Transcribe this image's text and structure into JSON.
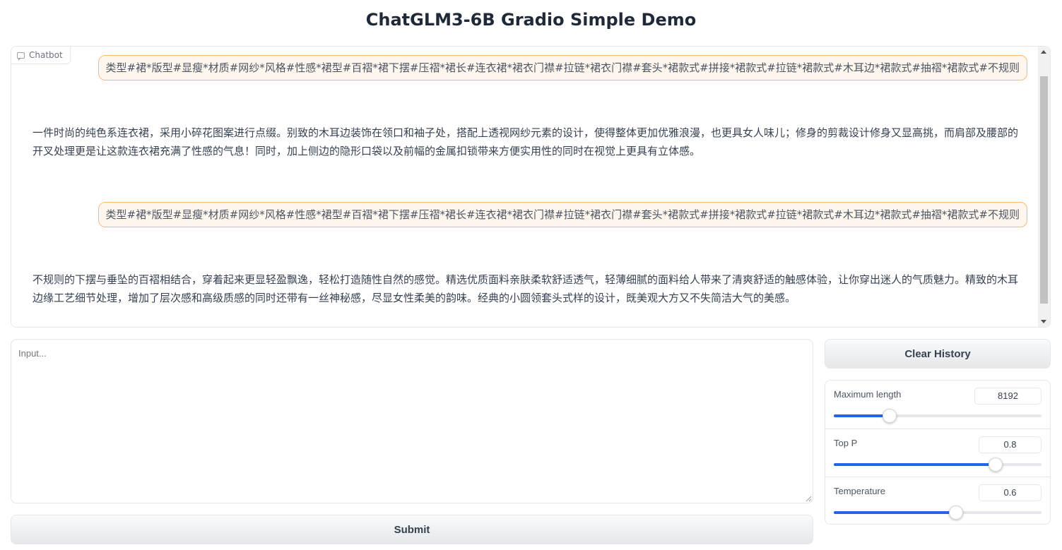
{
  "page": {
    "title": "ChatGLM3-6B Gradio Simple Demo"
  },
  "chatbot": {
    "label": "Chatbot",
    "icon": "chat-bubble-icon",
    "messages": [
      {
        "role": "user",
        "text": "类型#裙*版型#显瘦*材质#网纱*风格#性感*裙型#百褶*裙下摆#压褶*裙长#连衣裙*裙衣门襟#拉链*裙衣门襟#套头*裙款式#拼接*裙款式#拉链*裙款式#木耳边*裙款式#抽褶*裙款式#不规则"
      },
      {
        "role": "assistant",
        "text": "一件时尚的纯色系连衣裙，采用小碎花图案进行点缀。别致的木耳边装饰在领口和袖子处，搭配上透视网纱元素的设计，使得整体更加优雅浪漫，也更具女人味儿；修身的剪裁设计修身又显高挑，而肩部及腰部的开叉处理更是让这款连衣裙充满了性感的气息！同时，加上侧边的隐形口袋以及前幅的金属扣锁带来方便实用性的同时在视觉上更具有立体感。"
      },
      {
        "role": "user",
        "text": "类型#裙*版型#显瘦*材质#网纱*风格#性感*裙型#百褶*裙下摆#压褶*裙长#连衣裙*裙衣门襟#拉链*裙衣门襟#套头*裙款式#拼接*裙款式#拉链*裙款式#木耳边*裙款式#抽褶*裙款式#不规则"
      },
      {
        "role": "assistant",
        "text": "不规则的下摆与垂坠的百褶相结合，穿着起来更显轻盈飘逸，轻松打造随性自然的感觉。精选优质面料亲肤柔软舒适透气，轻薄细腻的面料给人带来了清爽舒适的触感体验，让你穿出迷人的气质魅力。精致的木耳边缘工艺细节处理，增加了层次感和高级质感的同时还带有一丝神秘感，尽显女性柔美的韵味。经典的小圆领套头式样的设计，既美观大方又不失简洁大气的美感。"
      }
    ]
  },
  "input": {
    "placeholder": "Input...",
    "value": ""
  },
  "buttons": {
    "submit": "Submit",
    "clear": "Clear History"
  },
  "params": {
    "max_length": {
      "label": "Maximum length",
      "value": "8192",
      "fraction": 0.27
    },
    "top_p": {
      "label": "Top P",
      "value": "0.8",
      "fraction": 0.78
    },
    "temperature": {
      "label": "Temperature",
      "value": "0.6",
      "fraction": 0.59
    }
  },
  "colors": {
    "accent": "#2563eb",
    "user_bubble_bg": "#fff7ed",
    "user_bubble_border": "#fdba74"
  }
}
